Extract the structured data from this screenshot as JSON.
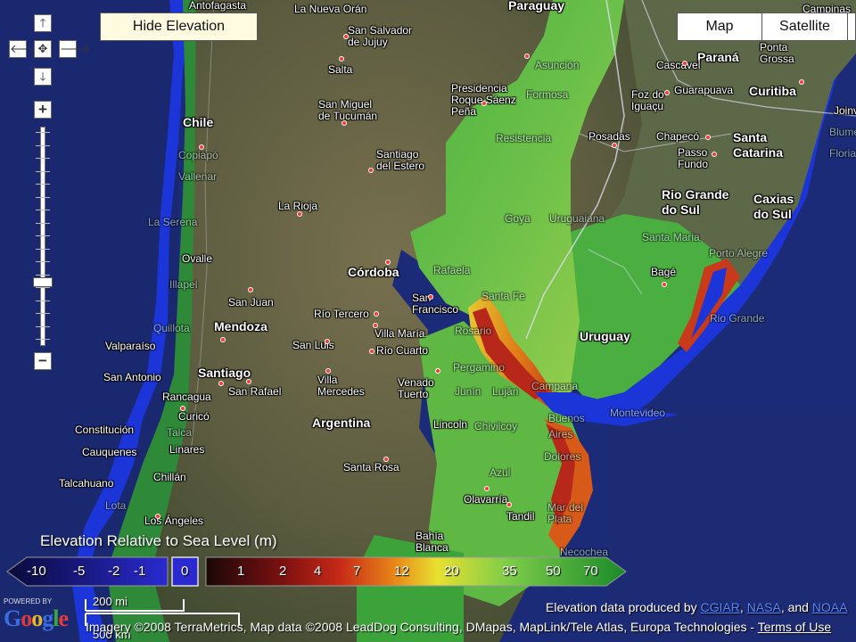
{
  "controls": {
    "pan_up": "🡑",
    "pan_left": "🡐",
    "pan_center": "✥",
    "pan_right": "🡒",
    "pan_down": "🡓",
    "zoom_in": "+",
    "zoom_out": "−",
    "zoom_level_fraction": 0.72,
    "hide_elevation_label": "Hide Elevation",
    "map_types": [
      "Map",
      "Satellite"
    ]
  },
  "legend": {
    "title": "Elevation Relative to Sea Level (m)",
    "negative_values": [
      "-10",
      "-5",
      "-2",
      "-1"
    ],
    "zero_value": "0",
    "positive_values": [
      "1",
      "2",
      "4",
      "7",
      "12",
      "20",
      "35",
      "50",
      "70"
    ]
  },
  "places": {
    "countries": [
      "Paraguay",
      "Chile",
      "Argentina",
      "Uruguay"
    ],
    "regions": [
      "Paraná",
      "Santa Catarina",
      "Rio Grande do Sul"
    ],
    "cities": [
      "Antofagasta",
      "La Nueva Orán",
      "San Salvador de Jujuy",
      "Salta",
      "Asunción",
      "Cascavel",
      "Ponta Grossa",
      "Campinas",
      "Presidencia Roque Sáenz Peña",
      "Formosa",
      "Foz do Iguaçu",
      "Guarapuava",
      "Curitiba",
      "Joinville",
      "Copiapó",
      "Vallenar",
      "San Miguel de Tucumán",
      "Resistencia",
      "Posadas",
      "Chapecó",
      "Blumenau",
      "Florianópolis",
      "Santiago del Estero",
      "Passo Fundo",
      "Caxias do Sul",
      "La Serena",
      "La Rioja",
      "Goya",
      "Uruguaiana",
      "Santa Maria",
      "Ovalle",
      "Rafaela",
      "Córdoba",
      "Bagé",
      "Porto Alegre",
      "Illapel",
      "San Juan",
      "San Francisco",
      "Santa Fe",
      "Río Tercero",
      "Mendoza",
      "Quillota",
      "Valparaíso",
      "San Luis",
      "Villa María",
      "Río Cuarto",
      "Rosario",
      "Rio Grande",
      "San Antonio",
      "Santiago",
      "Pergamino",
      "Rancagua",
      "San Rafael",
      "Villa Mercedes",
      "Venado Tuerto",
      "Junín",
      "Luján",
      "Campana",
      "Curicó",
      "Talca",
      "Linares",
      "Constitución",
      "Cauquenes",
      "Chillán",
      "Lincoln",
      "Chivilcoy",
      "Buenos Aires",
      "Montevideo",
      "Santa Rosa",
      "Dolores",
      "Azul",
      "Talcahuano",
      "Olavarría",
      "Lota",
      "Los Ángeles",
      "Tandil",
      "Mar del Plata",
      "Bahía Blanca",
      "Necochea"
    ]
  },
  "footer": {
    "powered_by": "POWERED BY",
    "google": "Google",
    "scale_mi": "200 mi",
    "scale_km": "500 km",
    "imagery": "Imagery ©2008 TerraMetrics, Map data ©2008 LeadDog Consulting, DMapas, MapLink/Tele Atlas, Europa Technologies -",
    "terms": "Terms of Use",
    "elevation_prefix": "Elevation data produced by",
    "elevation_sources": [
      "CGIAR",
      "NASA",
      "NOAA"
    ],
    "elevation_and": "and"
  },
  "colors": {
    "ocean": "#1c2b78",
    "flood_blue": "#1c35d8",
    "lowland_red": "#b8281a",
    "lowland_orange": "#e07a18",
    "lowland_yellow": "#d8d030",
    "lowland_green": "#3ea83a",
    "terrain": "#6a6a48",
    "legend_panel": "#2a2a70"
  }
}
